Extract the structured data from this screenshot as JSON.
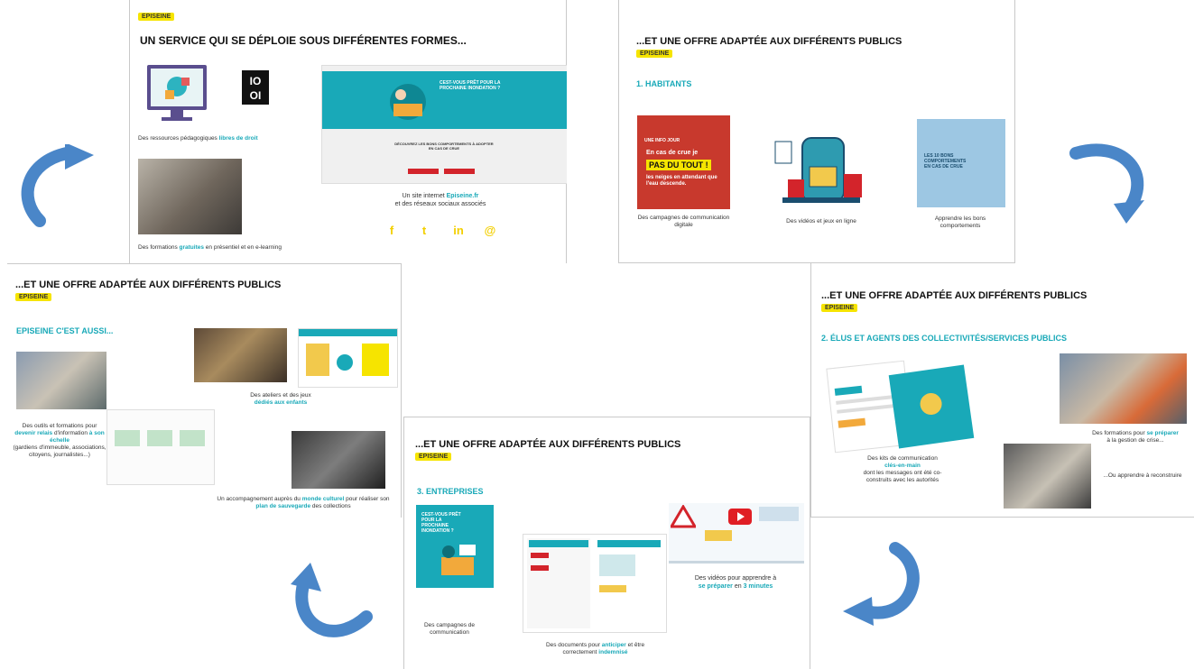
{
  "slides": {
    "top_left": {
      "badge": "EPISEINE",
      "title": "UN SERVICE QUI SE DÉPLOIE SOUS DIFFÉRENTES FORMES...",
      "cap_resources_pre": "Des ressources pédagogiques ",
      "cap_resources_hl": "libres de droit",
      "cap_site_pre": "Un site internet ",
      "cap_site_hl": "Episeine.fr",
      "cap_site_post": "et des réseaux sociaux associés",
      "cap_formations_pre": "Des formations ",
      "cap_formations_hl": "gratuites",
      "cap_formations_post": " en présentiel et en e-learning",
      "site_mock_text": "CEST-VOUS PRÊT POUR LA PROCHAINE INONDATION ?",
      "site_mock_sub": "DÉCOUVREZ LES BONS COMPORTEMENTS À ADOPTER EN CAS DE CRUE",
      "social": [
        "f",
        "t",
        "in",
        "@"
      ]
    },
    "top_right": {
      "title": "...ET UNE OFFRE ADAPTÉE AUX DIFFÉRENTS PUBLICS",
      "badge": "EPISEINE",
      "subtitle": "1. HABITANTS",
      "poster_line1": "UNE INFO JOUR",
      "poster_line2": "En cas de crue je",
      "poster_hl": "PAS DU TOUT !",
      "poster_line3": "les neiges en attendant que l'eau descende.",
      "bad_habits": "LES 10 BONS COMPORTEMENTS EN CAS DE CRUE",
      "cap_campaigns": "Des campagnes de communication digitale",
      "cap_videos": "Des vidéos et jeux en ligne",
      "cap_learn": "Apprendre les bons comportements"
    },
    "middle_left": {
      "title": "...ET UNE OFFRE ADAPTÉE AUX DIFFÉRENTS PUBLICS",
      "badge": "EPISEINE",
      "subtitle": "EPISEINE C'EST AUSSI...",
      "cap_tools_pre": "Des outils et formations pour ",
      "cap_tools_hl1": "devenir relais",
      "cap_tools_mid": " d'information ",
      "cap_tools_hl2": "à son échelle",
      "cap_tools_post": "(gardiens d'immeuble, associations, citoyens, journalistes...)",
      "cap_workshops": "Des ateliers et des jeux",
      "cap_workshops_hl": "dédiés aux enfants",
      "cap_culture_pre": "Un accompagnement auprès du ",
      "cap_culture_hl1": "monde culturel",
      "cap_culture_mid": " pour réaliser son ",
      "cap_culture_hl2": "plan de sauvegarde",
      "cap_culture_post": " des collections"
    },
    "middle_right": {
      "title": "...ET UNE OFFRE ADAPTÉE AUX DIFFÉRENTS PUBLICS",
      "badge": "EPISEINE",
      "subtitle": "2. ÉLUS ET AGENTS DES COLLECTIVITÉS/SERVICES PUBLICS",
      "cap_kits_pre": "Des kits de communication ",
      "cap_kits_hl": "clés-en-main",
      "cap_kits_post": "dont les messages ont été co-construits avec les autorités",
      "cap_train_pre": "Des formations pour ",
      "cap_train_hl": "se préparer",
      "cap_train_post": "à la gestion de crise...",
      "cap_recover": "...Ou apprendre à reconstruire"
    },
    "bottom": {
      "title": "...ET UNE OFFRE ADAPTÉE AUX DIFFÉRENTS PUBLICS",
      "badge": "EPISEINE",
      "subtitle": "3. ENTREPRISES",
      "poster_text": "CEST-VOUS PRÊT POUR LA PROCHAINE INONDATION ?",
      "cap_campaigns": "Des campagnes de communication",
      "cap_docs_pre": "Des documents pour ",
      "cap_docs_hl1": "anticiper",
      "cap_docs_mid": " et être correctement ",
      "cap_docs_hl2": "indemnisé",
      "cap_videos_pre": "Des vidéos pour apprendre à ",
      "cap_videos_hl1": "se préparer",
      "cap_videos_mid": " en ",
      "cap_videos_hl2": "3 minutes"
    }
  },
  "colors": {
    "teal": "#19a9b8",
    "yellow": "#f6e400",
    "arrow": "#4a86c8",
    "red": "#d3242b"
  }
}
